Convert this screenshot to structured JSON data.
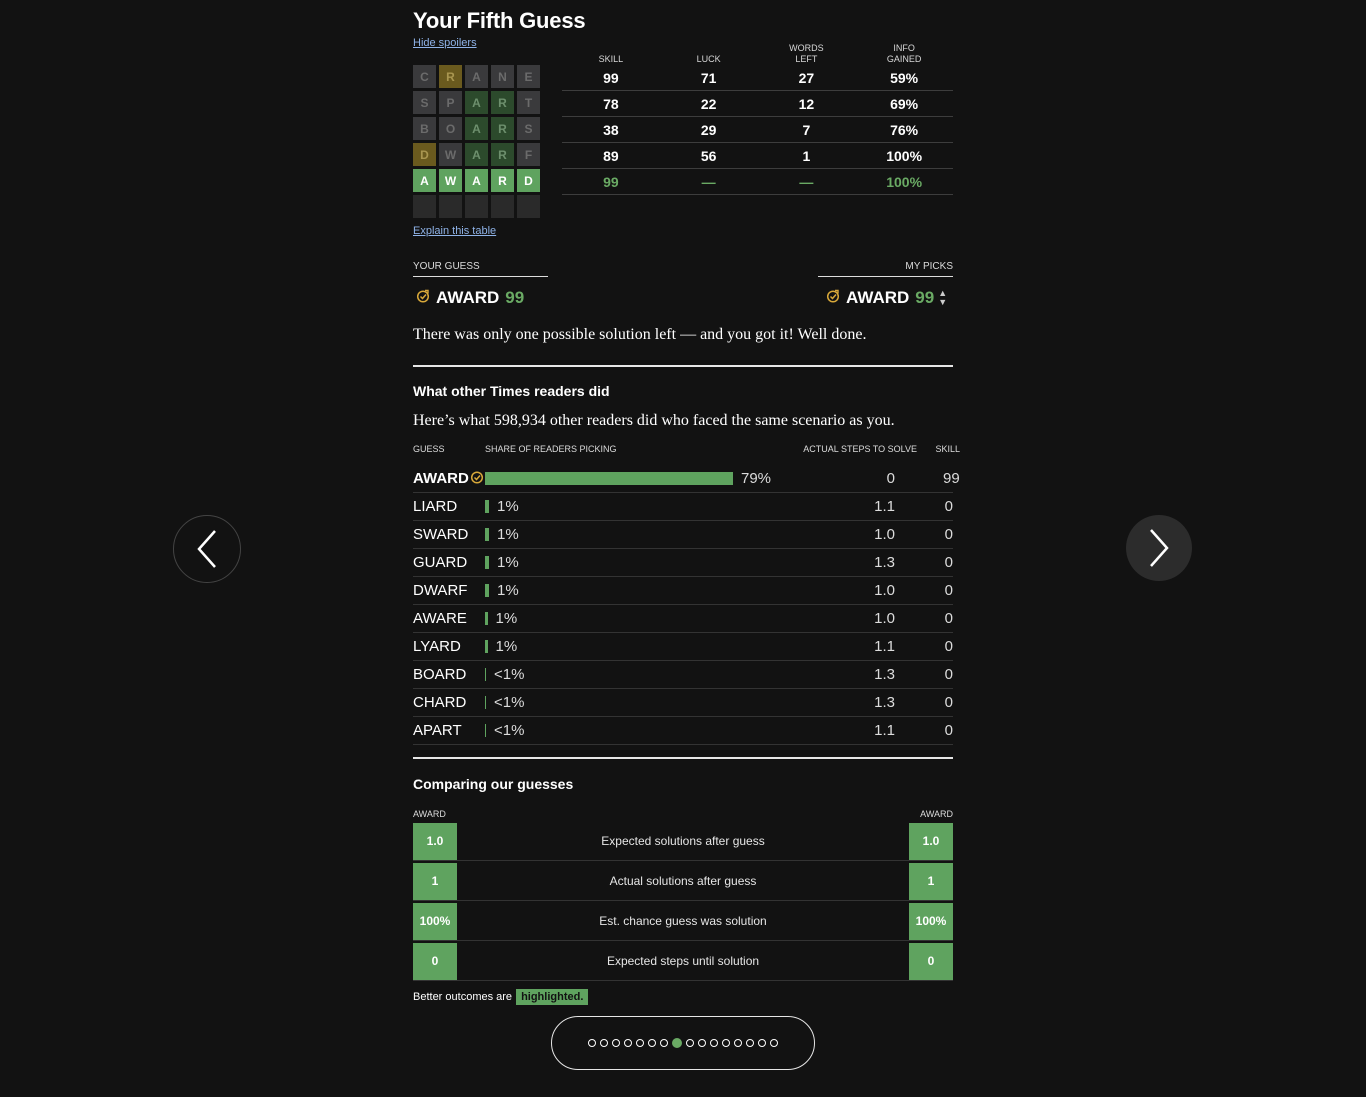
{
  "header": {
    "title": "Your Fifth Guess",
    "hide_spoilers": "Hide spoilers"
  },
  "board": {
    "rows": [
      {
        "letters": [
          "C",
          "R",
          "A",
          "N",
          "E"
        ],
        "states": [
          "absent",
          "present",
          "absent",
          "absent",
          "absent"
        ]
      },
      {
        "letters": [
          "S",
          "P",
          "A",
          "R",
          "T"
        ],
        "states": [
          "absent",
          "absent",
          "correct",
          "correct",
          "absent"
        ]
      },
      {
        "letters": [
          "B",
          "O",
          "A",
          "R",
          "S"
        ],
        "states": [
          "absent",
          "absent",
          "correct",
          "correct",
          "absent"
        ]
      },
      {
        "letters": [
          "D",
          "W",
          "A",
          "R",
          "F"
        ],
        "states": [
          "present",
          "absent",
          "correct",
          "correct",
          "absent"
        ]
      },
      {
        "letters": [
          "A",
          "W",
          "A",
          "R",
          "D"
        ],
        "states": [
          "win",
          "win",
          "win",
          "win",
          "win"
        ]
      },
      {
        "letters": [
          "",
          "",
          "",
          "",
          ""
        ],
        "states": [
          "empty",
          "empty",
          "empty",
          "empty",
          "empty"
        ]
      }
    ],
    "explain_link": "Explain this table"
  },
  "stats": {
    "headers": [
      "SKILL",
      "LUCK",
      "WORDS\nLEFT",
      "INFO\nGAINED"
    ],
    "rows": [
      [
        "99",
        "71",
        "27",
        "59%"
      ],
      [
        "78",
        "22",
        "12",
        "69%"
      ],
      [
        "38",
        "29",
        "7",
        "76%"
      ],
      [
        "89",
        "56",
        "1",
        "100%"
      ],
      [
        "99",
        "—",
        "—",
        "100%"
      ]
    ]
  },
  "comparison_top": {
    "your_label": "YOUR GUESS",
    "your_word": "AWARD",
    "your_score": "99",
    "my_label": "MY PICKS",
    "my_word": "AWARD",
    "my_score": "99",
    "summary": "There was only one possible solution left — and you got it! Well done."
  },
  "readers": {
    "heading": "What other Times readers did",
    "intro": "Here’s what 598,934 other readers did who faced the same scenario as you.",
    "col_guess": "GUESS",
    "col_share": "SHARE OF READERS PICKING",
    "col_steps": "ACTUAL STEPS TO SOLVE",
    "col_skill": "SKILL",
    "rows": [
      {
        "word": "AWARD",
        "pct": "79%",
        "share": 0.79,
        "steps": "0",
        "skill": "99",
        "yours": true
      },
      {
        "word": "LIARD",
        "pct": "1%",
        "share": 0.01,
        "steps": "1.1",
        "skill": "0"
      },
      {
        "word": "SWARD",
        "pct": "1%",
        "share": 0.01,
        "steps": "1.0",
        "skill": "0"
      },
      {
        "word": "GUARD",
        "pct": "1%",
        "share": 0.01,
        "steps": "1.3",
        "skill": "0"
      },
      {
        "word": "DWARF",
        "pct": "1%",
        "share": 0.01,
        "steps": "1.0",
        "skill": "0"
      },
      {
        "word": "AWARE",
        "pct": "1%",
        "share": 0.008,
        "steps": "1.0",
        "skill": "0"
      },
      {
        "word": "LYARD",
        "pct": "1%",
        "share": 0.008,
        "steps": "1.1",
        "skill": "0"
      },
      {
        "word": "BOARD",
        "pct": "<1%",
        "share": 0.004,
        "steps": "1.3",
        "skill": "0"
      },
      {
        "word": "CHARD",
        "pct": "<1%",
        "share": 0.004,
        "steps": "1.3",
        "skill": "0"
      },
      {
        "word": "APART",
        "pct": "<1%",
        "share": 0.004,
        "steps": "1.1",
        "skill": "0"
      }
    ]
  },
  "compare": {
    "heading": "Comparing our guesses",
    "left_word": "AWARD",
    "right_word": "AWARD",
    "rows": [
      {
        "label": "Expected solutions after guess",
        "left": "1.0",
        "right": "1.0"
      },
      {
        "label": "Actual solutions after guess",
        "left": "1",
        "right": "1"
      },
      {
        "label": "Est. chance guess was solution",
        "left": "100%",
        "right": "100%"
      },
      {
        "label": "Expected steps until solution",
        "left": "0",
        "right": "0"
      }
    ],
    "footnote": "Better outcomes are",
    "footnote_tag": "highlighted."
  },
  "pager": {
    "count": 16,
    "active_index": 7
  },
  "colors": {
    "background": "#121212",
    "green": "#6aaa64",
    "present": "#6a5a1e",
    "absent": "#3a3a3c"
  },
  "icons": {
    "prev": "chevron-left-icon",
    "next": "chevron-right-icon",
    "pick": "check-circle-icon",
    "sort": "sort-arrows-icon"
  }
}
